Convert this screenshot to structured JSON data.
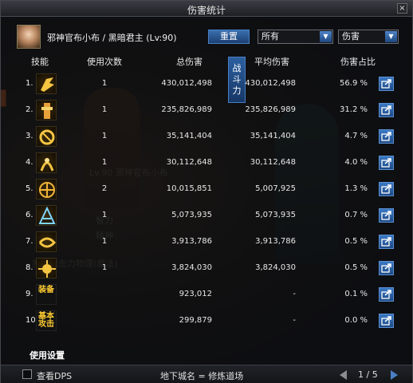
{
  "window": {
    "title": "伤害统计",
    "close_label": "×"
  },
  "header": {
    "character_name": "邪神官布小布 / 黑暗君主 (Lv:90)",
    "reset_label": "重置",
    "filter_selected": "所有",
    "type_selected": "伤害"
  },
  "columns": {
    "skill": "技能",
    "uses": "使用次数",
    "total": "总伤害",
    "avg": "平均伤害",
    "pct": "伤害占比"
  },
  "combat_power_button": "战斗力",
  "rows": [
    {
      "rank": "1.",
      "icon": "skill-icon-1",
      "uses": "1",
      "total": "430,012,498",
      "avg": "430,012,498",
      "pct": "56.9 %"
    },
    {
      "rank": "2.",
      "icon": "skill-icon-2",
      "uses": "1",
      "total": "235,826,989",
      "avg": "235,826,989",
      "pct": "31.2 %"
    },
    {
      "rank": "3.",
      "icon": "skill-icon-3",
      "uses": "1",
      "total": "35,141,404",
      "avg": "35,141,404",
      "pct": "4.7 %"
    },
    {
      "rank": "4.",
      "icon": "skill-icon-4",
      "uses": "1",
      "total": "30,112,648",
      "avg": "30,112,648",
      "pct": "4.0 %"
    },
    {
      "rank": "5.",
      "icon": "skill-icon-5",
      "uses": "2",
      "total": "10,015,851",
      "avg": "5,007,925",
      "pct": "1.3 %"
    },
    {
      "rank": "6.",
      "icon": "skill-icon-6",
      "uses": "1",
      "total": "5,073,935",
      "avg": "5,073,935",
      "pct": "0.7 %"
    },
    {
      "rank": "7.",
      "icon": "skill-icon-7",
      "uses": "1",
      "total": "3,913,786",
      "avg": "3,913,786",
      "pct": "0.5 %"
    },
    {
      "rank": "8.",
      "icon": "skill-icon-8",
      "uses": "1",
      "total": "3,824,030",
      "avg": "3,824,030",
      "pct": "0.5 %"
    },
    {
      "rank": "9.",
      "icon_text": "装备",
      "uses": "",
      "total": "923,012",
      "avg": "-",
      "pct": "0.1 %"
    },
    {
      "rank": "10.",
      "icon_text": "基本攻击",
      "uses": "",
      "total": "299,879",
      "avg": "-",
      "pct": "0.0 %"
    }
  ],
  "settings_label": "使用设置",
  "footer": {
    "checkbox_label": "查看DPS",
    "dungeon_label": "地下城名 = 修炼道场",
    "page": "1 / 5"
  },
  "colors": {
    "accent": "#3a6fb0",
    "icon_gold": "#f5c542",
    "text": "#e8e8e8"
  }
}
